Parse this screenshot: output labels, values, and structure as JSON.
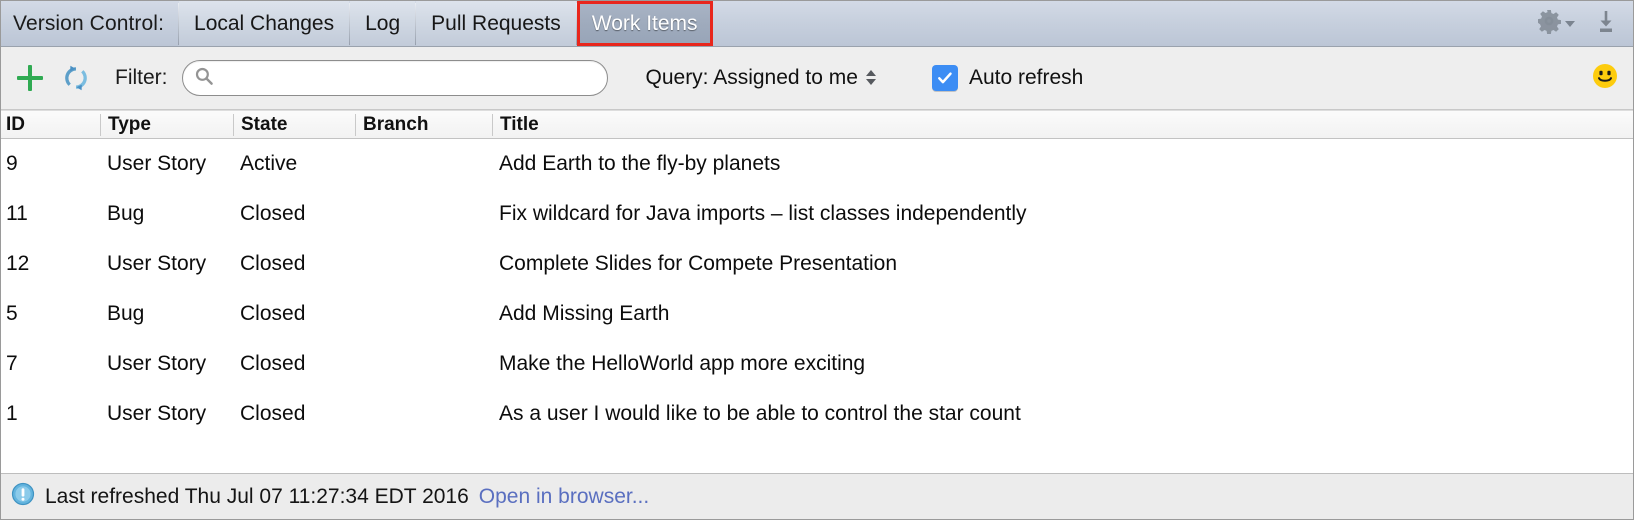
{
  "tabbar": {
    "title": "Version Control:",
    "tabs": [
      {
        "label": "Local Changes",
        "selected": false
      },
      {
        "label": "Log",
        "selected": false
      },
      {
        "label": "Pull Requests",
        "selected": false
      },
      {
        "label": "Work Items",
        "selected": true
      }
    ],
    "gear_icon": "gear-icon",
    "gear_caret_icon": "chevron-down-icon",
    "hide_icon": "hide-panel-icon",
    "selected_tab_highlight_color": "#e8261c",
    "selected_tab_bg": "#9fabbd"
  },
  "toolbar": {
    "add_icon": "plus-icon",
    "add_icon_color": "#2faa52",
    "refresh_icon": "refresh-icon",
    "refresh_icon_color": "#4a90c4",
    "filter_label": "Filter:",
    "search": {
      "icon": "search-icon",
      "value": "",
      "placeholder": ""
    },
    "query": {
      "label": "Query: Assigned to me",
      "stepper_icon": "updown-stepper-icon"
    },
    "auto_refresh": {
      "label": "Auto refresh",
      "checked": true,
      "check_color": "#3c8df4"
    },
    "smiley_icon": "smiley-face-icon",
    "smiley_color": "#fdcc0d"
  },
  "table": {
    "columns": [
      "ID",
      "Type",
      "State",
      "Branch",
      "Title"
    ],
    "rows": [
      {
        "id": "9",
        "type": "User Story",
        "state": "Active",
        "branch": "",
        "title": "Add Earth to the fly-by planets"
      },
      {
        "id": "11",
        "type": "Bug",
        "state": "Closed",
        "branch": "",
        "title": "Fix wildcard for Java imports – list classes independently"
      },
      {
        "id": "12",
        "type": "User Story",
        "state": "Closed",
        "branch": "",
        "title": "Complete Slides for Compete Presentation"
      },
      {
        "id": "5",
        "type": "Bug",
        "state": "Closed",
        "branch": "",
        "title": "Add Missing Earth"
      },
      {
        "id": "7",
        "type": "User Story",
        "state": "Closed",
        "branch": "",
        "title": "Make the HelloWorld app more exciting"
      },
      {
        "id": "1",
        "type": "User Story",
        "state": "Closed",
        "branch": "",
        "title": "As a user I would like to be able to control the star count"
      }
    ]
  },
  "statusbar": {
    "info_icon": "info-icon",
    "message": "Last refreshed Thu Jul 07 11:27:34 EDT 2016",
    "link": "Open in browser..."
  }
}
